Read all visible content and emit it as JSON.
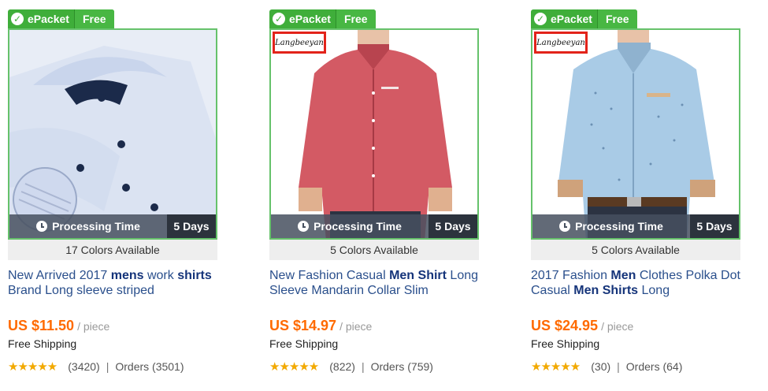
{
  "colors": {
    "badge_green": "#3fae3a",
    "frame_green": "#66c26b",
    "price_orange": "#ff6a00",
    "title_blue": "#2a4f8c",
    "brand_red": "#e2231a"
  },
  "products": [
    {
      "badge_left": "ePacket",
      "badge_right": "Free",
      "processing_label": "Processing Time",
      "processing_days": "5 Days",
      "colors_available": "17 Colors Available",
      "title_parts": [
        "New Arrived 2017 ",
        "mens",
        " work ",
        "shirts",
        " Brand Long sleeve striped"
      ],
      "price": "US $11.50",
      "unit": "/ piece",
      "shipping": "Free Shipping",
      "stars": "★★★★★",
      "reviews": "(3420)",
      "orders": "Orders (3501)",
      "brand": ""
    },
    {
      "badge_left": "ePacket",
      "badge_right": "Free",
      "processing_label": "Processing Time",
      "processing_days": "5 Days",
      "colors_available": "5 Colors Available",
      "title_parts": [
        "New Fashion Casual ",
        "Men Shirt",
        " Long Sleeve Mandarin Collar Slim",
        "",
        ""
      ],
      "price": "US $14.97",
      "unit": "/ piece",
      "shipping": "Free Shipping",
      "stars": "★★★★★",
      "reviews": "(822)",
      "orders": "Orders (759)",
      "brand": "Langbeeyan"
    },
    {
      "badge_left": "ePacket",
      "badge_right": "Free",
      "processing_label": "Processing Time",
      "processing_days": "5 Days",
      "colors_available": "5 Colors Available",
      "title_parts": [
        "2017 Fashion ",
        "Men",
        " Clothes Polka Dot Casual ",
        "Men Shirts",
        " Long"
      ],
      "price": "US $24.95",
      "unit": "/ piece",
      "shipping": "Free Shipping",
      "stars": "★★★★★",
      "reviews": "(30)",
      "orders": "Orders (64)",
      "brand": "Langbeeyan"
    }
  ]
}
